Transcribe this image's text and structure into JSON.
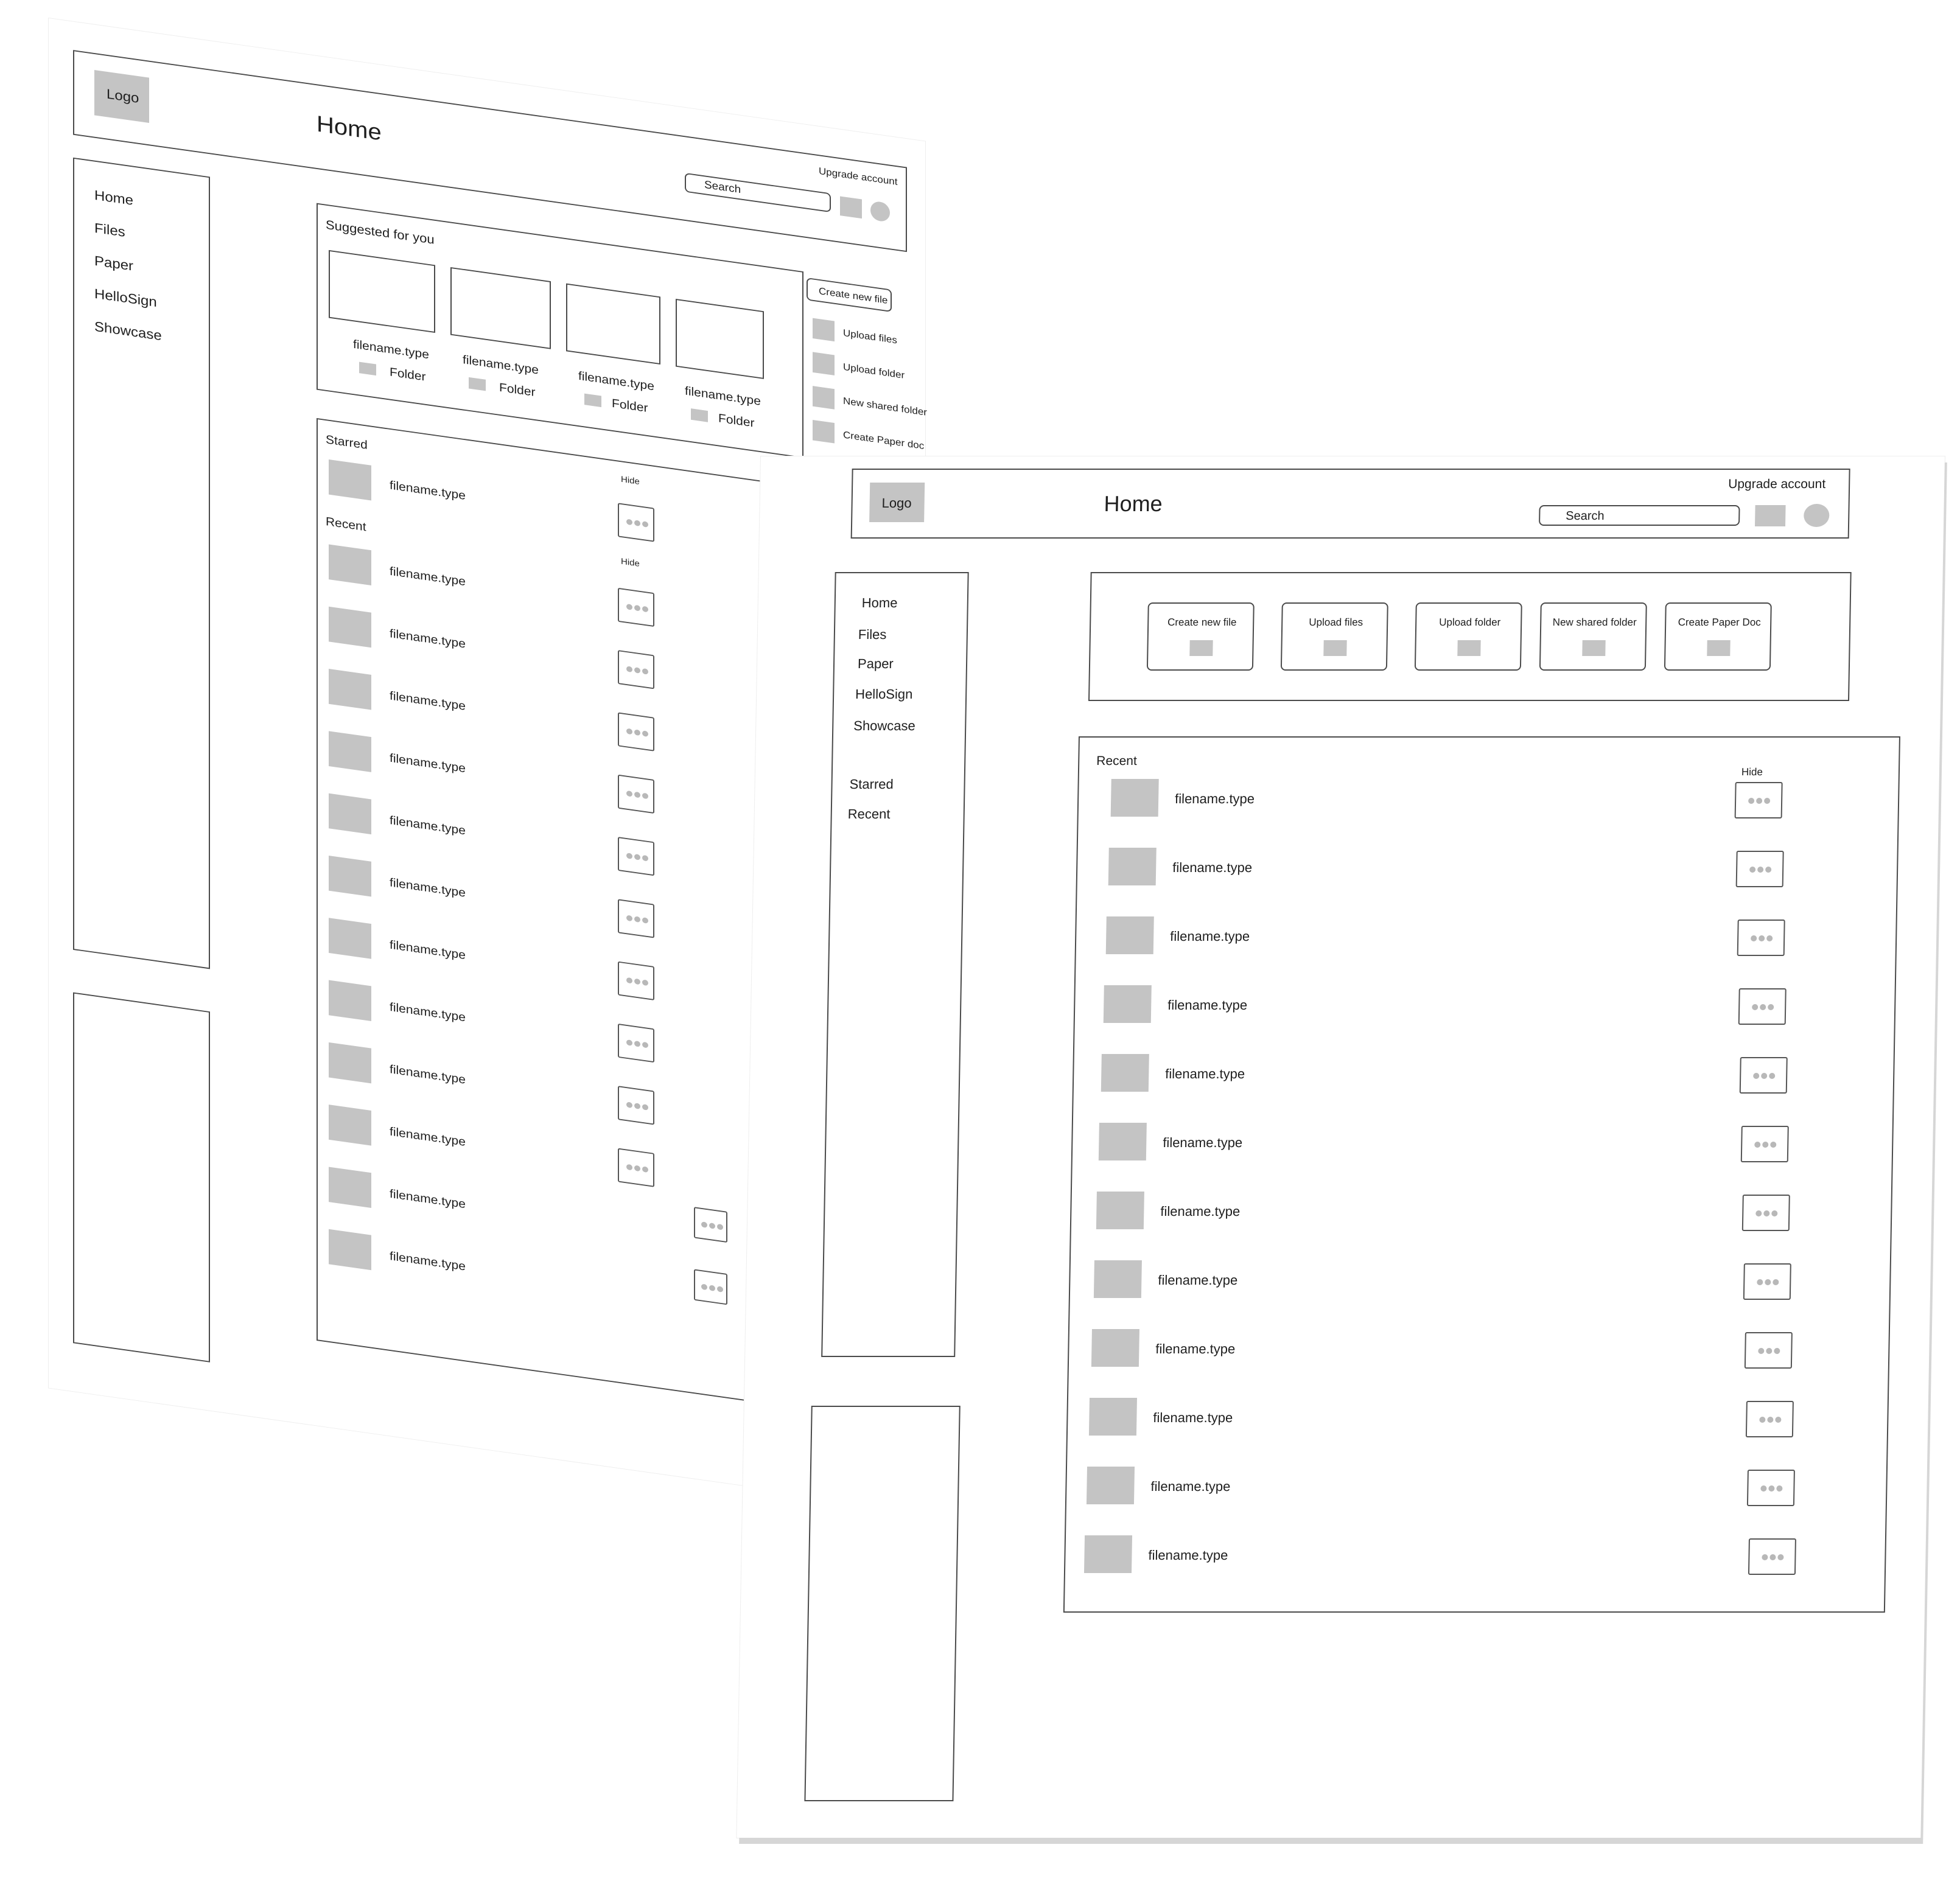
{
  "back_wireframe": {
    "logo": "Logo",
    "page_title": "Home",
    "search_placeholder": "Search",
    "upgrade_label": "Upgrade account",
    "nav": [
      "Home",
      "Files",
      "Paper",
      "HelloSign",
      "Showcase"
    ],
    "suggested_heading": "Suggested for you",
    "suggested_items": [
      {
        "filename": "filename.type",
        "folder": "Folder"
      },
      {
        "filename": "filename.type",
        "folder": "Folder"
      },
      {
        "filename": "filename.type",
        "folder": "Folder"
      },
      {
        "filename": "filename.type",
        "folder": "Folder"
      }
    ],
    "actions": [
      "Create new file",
      "Upload files",
      "Upload folder",
      "New shared folder",
      "Create Paper doc"
    ],
    "starred_heading": "Starred",
    "hide_label": "Hide",
    "starred_files": [
      "filename.type"
    ],
    "recent_heading": "Recent",
    "recent_files": [
      "filename.type",
      "filename.type",
      "filename.type",
      "filename.type",
      "filename.type",
      "filename.type",
      "filename.type",
      "filename.type",
      "filename.type",
      "filename.type",
      "filename.type",
      "filename.type"
    ]
  },
  "front_wireframe": {
    "logo": "Logo",
    "page_title": "Home",
    "search_placeholder": "Search",
    "upgrade_label": "Upgrade account",
    "nav": [
      "Home",
      "Files",
      "Paper",
      "HelloSign",
      "Showcase"
    ],
    "nav_secondary": [
      "Starred",
      "Recent"
    ],
    "actions": [
      "Create new file",
      "Upload files",
      "Upload folder",
      "New shared folder",
      "Create Paper Doc"
    ],
    "recent_heading": "Recent",
    "hide_label": "Hide",
    "recent_files": [
      "filename.type",
      "filename.type",
      "filename.type",
      "filename.type",
      "filename.type",
      "filename.type",
      "filename.type",
      "filename.type",
      "filename.type",
      "filename.type",
      "filename.type",
      "filename.type"
    ]
  }
}
